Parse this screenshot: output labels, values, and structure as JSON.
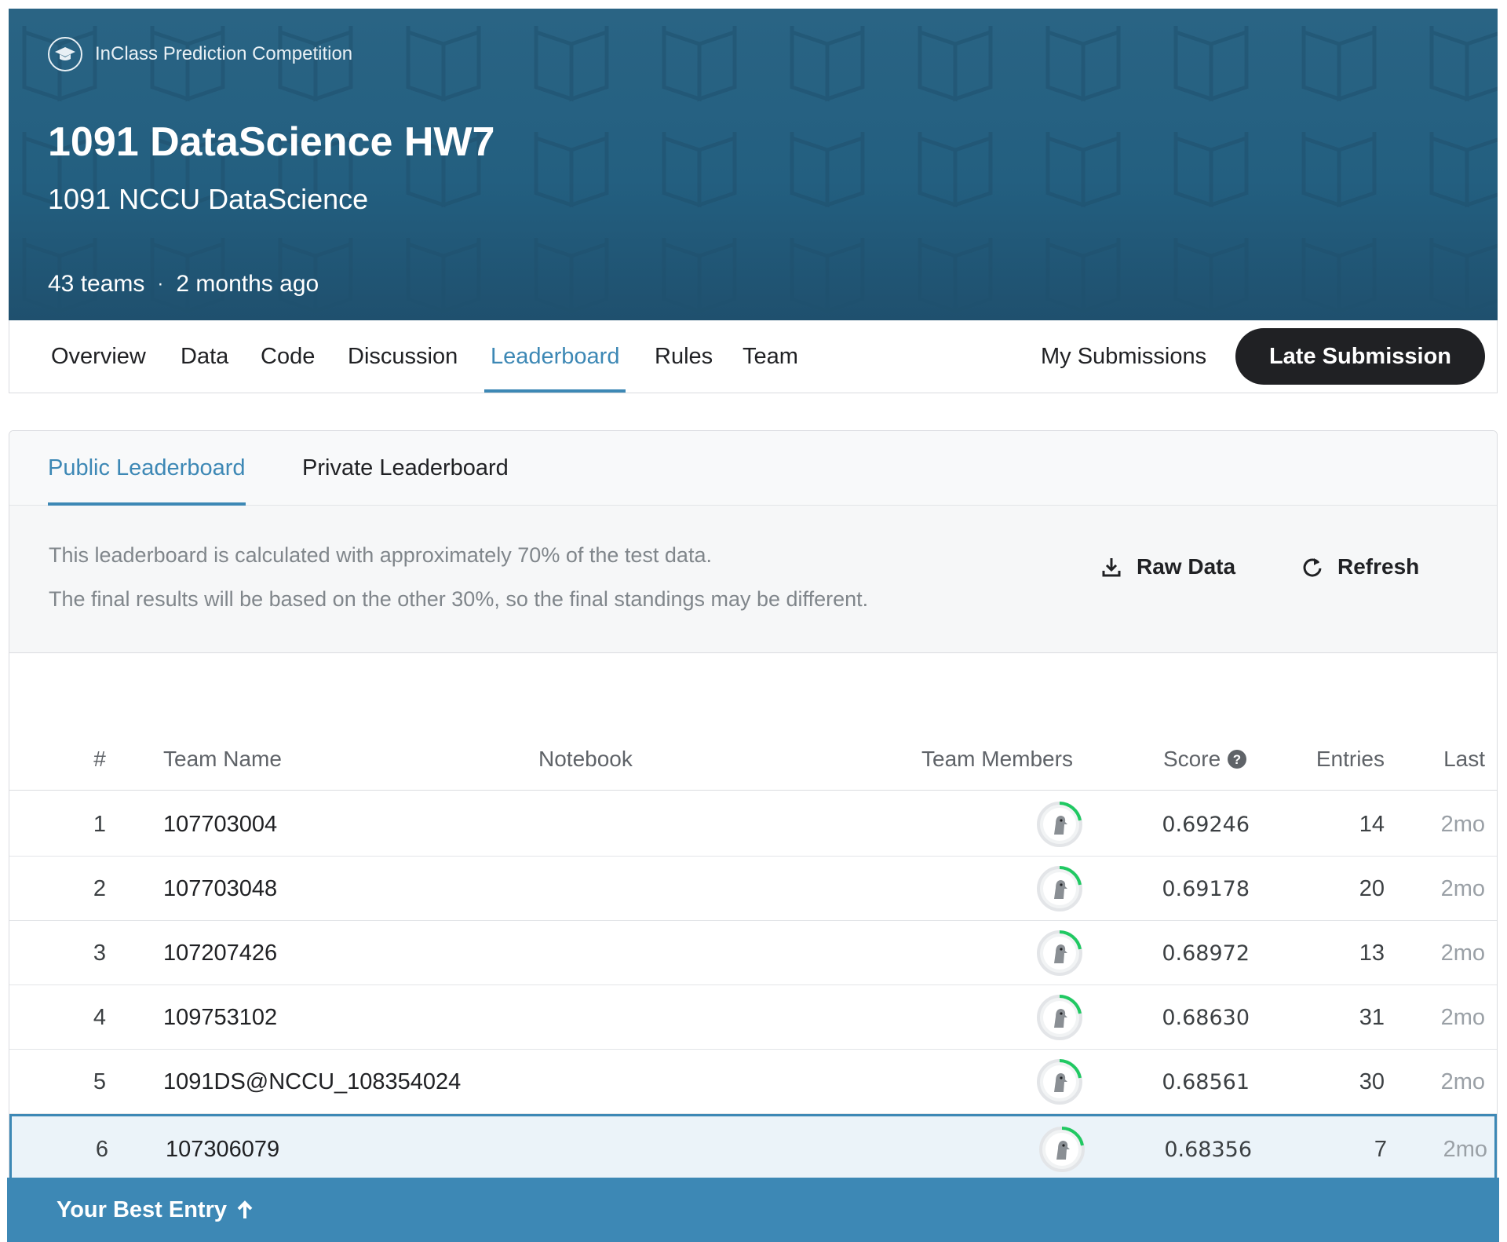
{
  "header": {
    "competition_type": "InClass Prediction Competition",
    "title": "1091 DataScience HW7",
    "subtitle": "1091 NCCU DataScience",
    "teams": "43 teams",
    "separator": "·",
    "age": "2 months ago",
    "background_color": "#2a6484"
  },
  "nav": {
    "tabs": [
      {
        "label": "Overview"
      },
      {
        "label": "Data"
      },
      {
        "label": "Code"
      },
      {
        "label": "Discussion"
      },
      {
        "label": "Leaderboard"
      },
      {
        "label": "Rules"
      },
      {
        "label": "Team"
      }
    ],
    "active_tab": "Leaderboard",
    "my_submissions": "My Submissions",
    "late_submission": "Late Submission"
  },
  "leaderboard": {
    "tabs": [
      {
        "label": "Public Leaderboard"
      },
      {
        "label": "Private Leaderboard"
      }
    ],
    "active_tab": "Public Leaderboard",
    "notice_line1": "This leaderboard is calculated with approximately 70% of the test data.",
    "notice_line2": "The final results will be based on the other 30%, so the final standings may be different.",
    "raw_data": "Raw Data",
    "refresh": "Refresh",
    "columns": {
      "rank": "#",
      "team_name": "Team Name",
      "notebook": "Notebook",
      "team_members": "Team Members",
      "score": "Score",
      "entries": "Entries",
      "last": "Last"
    },
    "rows": [
      {
        "rank": "1",
        "team": "107703004",
        "score": "0.69246",
        "entries": "14",
        "last": "2mo"
      },
      {
        "rank": "2",
        "team": "107703048",
        "score": "0.69178",
        "entries": "20",
        "last": "2mo"
      },
      {
        "rank": "3",
        "team": "107207426",
        "score": "0.68972",
        "entries": "13",
        "last": "2mo"
      },
      {
        "rank": "4",
        "team": "109753102",
        "score": "0.68630",
        "entries": "31",
        "last": "2mo"
      },
      {
        "rank": "5",
        "team": "1091DS@NCCU_108354024",
        "score": "0.68561",
        "entries": "30",
        "last": "2mo"
      },
      {
        "rank": "6",
        "team": "107306079",
        "score": "0.68356",
        "entries": "7",
        "last": "2mo"
      }
    ],
    "best_entry_label": "Your Best Entry",
    "accent_color": "#3d88b5"
  }
}
